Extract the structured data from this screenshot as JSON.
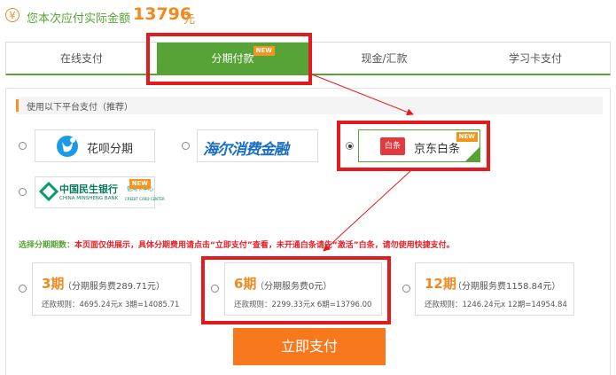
{
  "header": {
    "yen_symbol": "¥",
    "label": "您本次应付实际金额",
    "amount": "13796",
    "unit": "元"
  },
  "tabs": [
    {
      "label": "在线支付"
    },
    {
      "label": "分期付款",
      "badge": "NEW"
    },
    {
      "label": "现金/汇款"
    },
    {
      "label": "学习卡支付"
    }
  ],
  "section_title": "使用以下平台支付（推荐）",
  "platforms": {
    "huabei": "花呗分期",
    "haier": "海尔消费金融",
    "jd_logo": "白条",
    "jd": "京东白条",
    "jd_badge": "NEW",
    "cmbc_cn": "中国民生银行",
    "cmbc_sub": "信用卡中心",
    "cmbc_en": "CHINA MINSHENG BANK",
    "cmbc_en_sub": "CREDIT CARD CENTER",
    "cmbc_badge": "NEW"
  },
  "notice": {
    "lead": "选择分期期数：",
    "text": "本页面仅供展示，具体分期费用请点击“立即支付”查看，未开通白条请先“激活”白条，请勿使用快捷支付。"
  },
  "plans": [
    {
      "term": "3期",
      "fee": "（分期服务费289.71元）",
      "rule": "还款规则：4695.24元x 3期=14085.71"
    },
    {
      "term": "6期",
      "fee": "（分期服务费0元）",
      "rule": "还款规则：2299.33元x 6期=13796.00"
    },
    {
      "term": "12期",
      "fee": "（分期服务费1158.84元）",
      "rule": "还款规则：1246.24元x 12期=14954.84"
    }
  ],
  "pay_button": "立即支付",
  "colors": {
    "green": "#58a338",
    "orange": "#f2891e",
    "red": "#e41a1c"
  }
}
